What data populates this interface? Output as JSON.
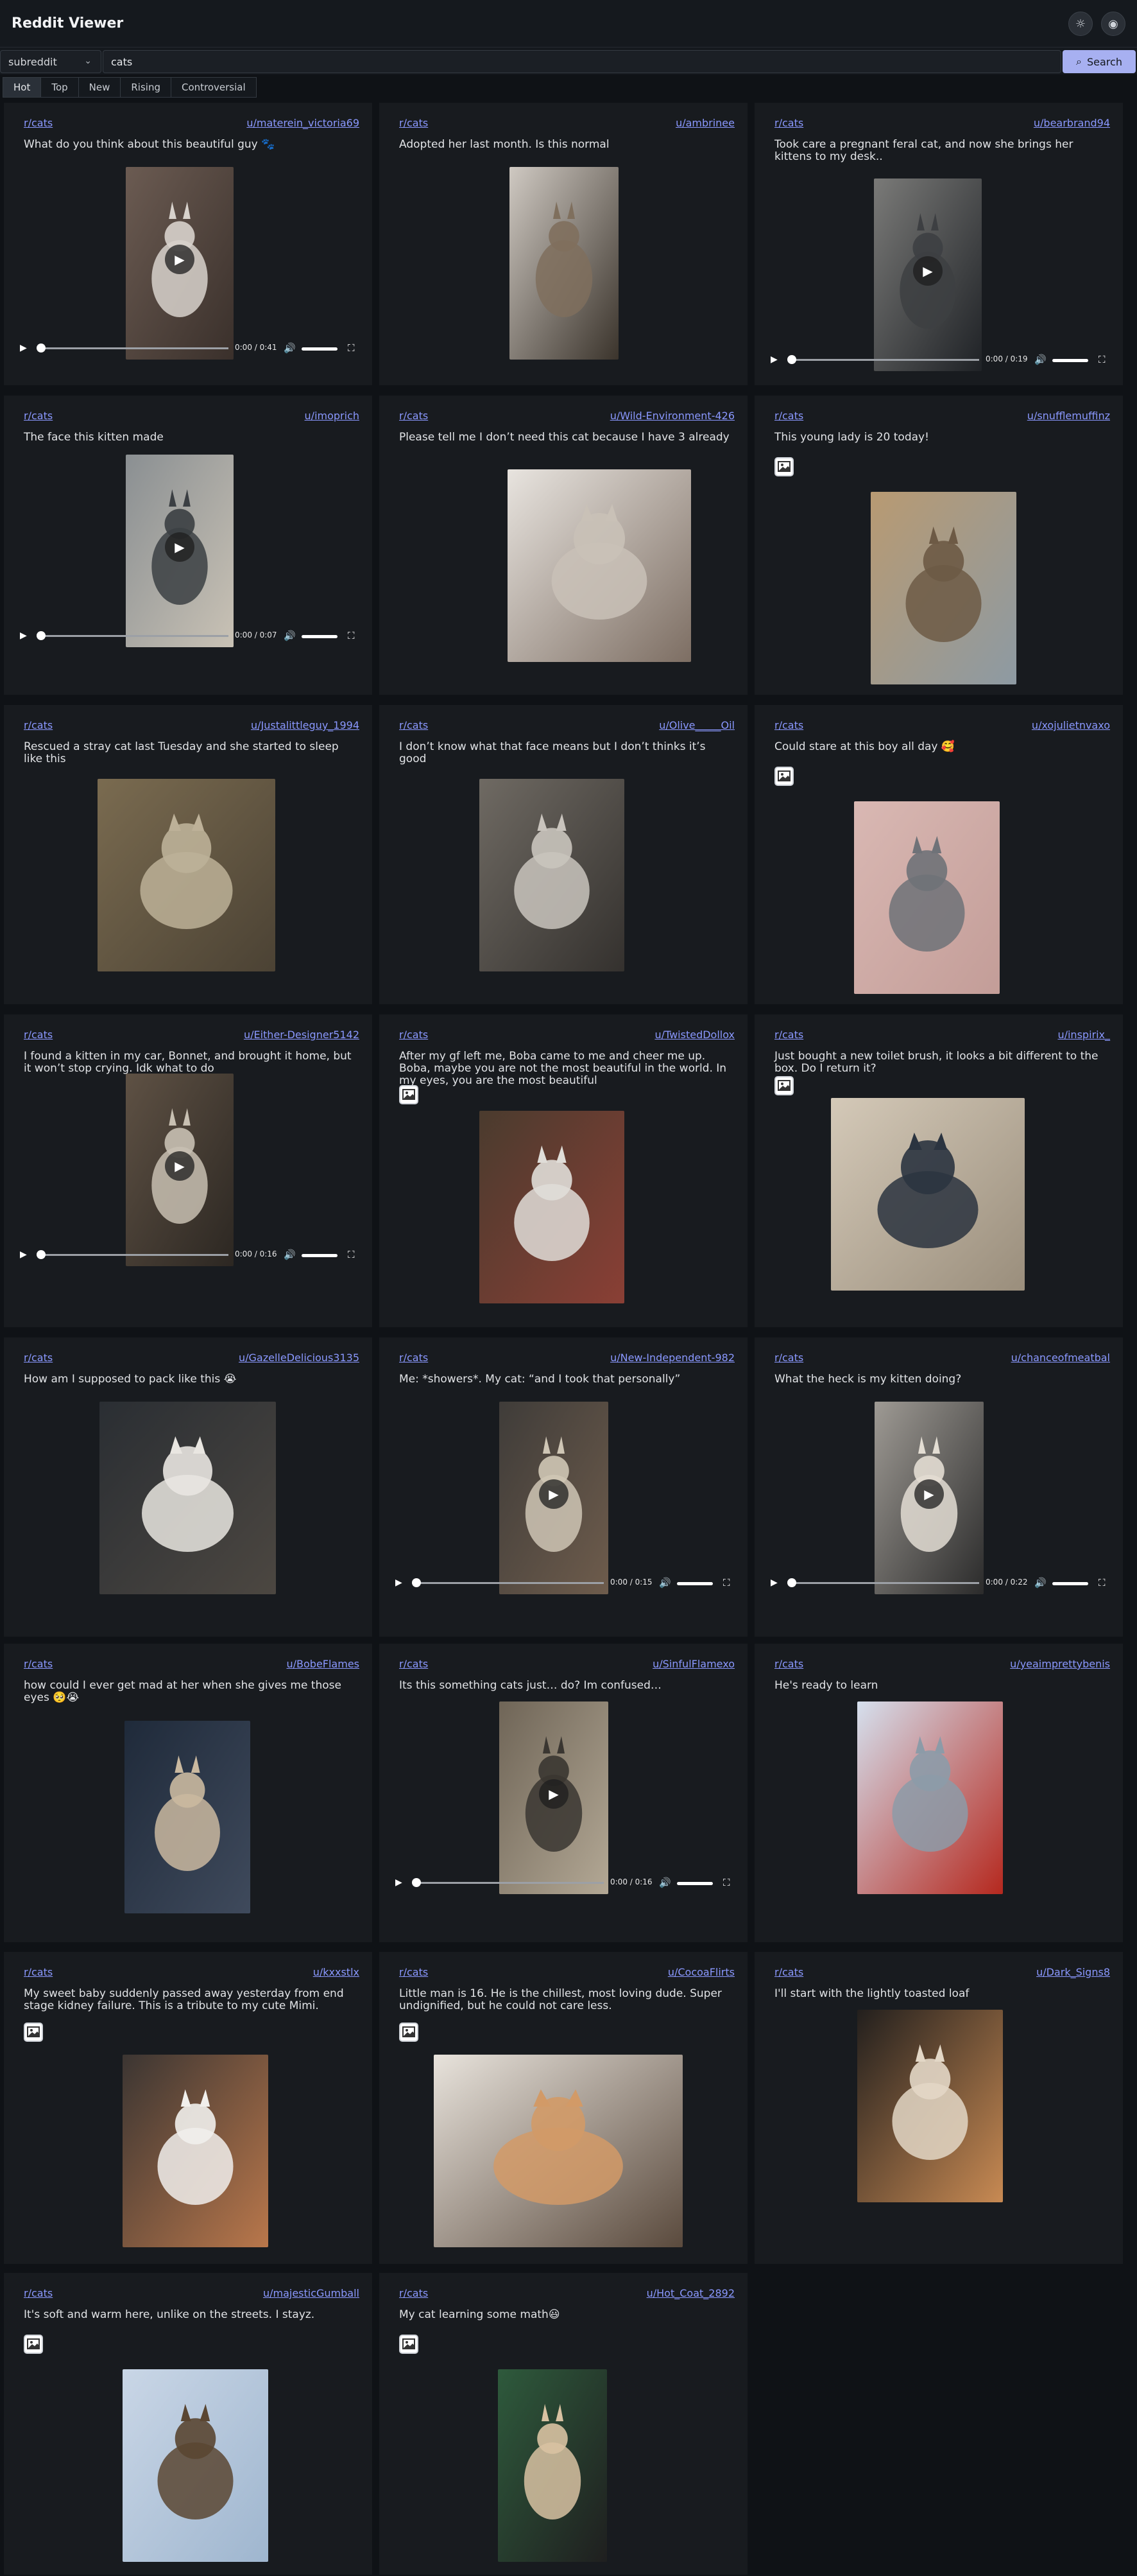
{
  "app": {
    "title": "Reddit Viewer"
  },
  "header": {
    "theme_icon": "sun-icon",
    "github_icon": "github-icon"
  },
  "search": {
    "select_value": "subreddit",
    "query": "cats",
    "button_label": "Search"
  },
  "tabs": [
    "Hot",
    "Top",
    "New",
    "Rising",
    "Controversial"
  ],
  "active_tab": "Hot",
  "posts": [
    {
      "sub": "r/cats",
      "user": "u/materein_victoria69",
      "title": "What do you think about this beautiful guy 🐾",
      "media": "video",
      "time": "0:00 / 0:41"
    },
    {
      "sub": "r/cats",
      "user": "u/ambrinee",
      "title": "Adopted her last month. Is this normal",
      "media": "image"
    },
    {
      "sub": "r/cats",
      "user": "u/bearbrand94",
      "title": "Took care a pregnant feral cat, and now she brings her kittens to my desk..",
      "media": "video",
      "time": "0:00 / 0:19"
    },
    {
      "sub": "r/cats",
      "user": "u/imoprich",
      "title": "The face this kitten made",
      "media": "video",
      "time": "0:00 / 0:07"
    },
    {
      "sub": "r/cats",
      "user": "u/Wild-Environment-426",
      "title": "Please tell me I don’t need this cat because I have 3 already",
      "media": "image"
    },
    {
      "sub": "r/cats",
      "user": "u/snufflemuffinz",
      "title": "This young lady is 20 today!",
      "media": "gallery"
    },
    {
      "sub": "r/cats",
      "user": "u/Justalittleguy_1994",
      "title": "Rescued a stray cat last Tuesday and she started to sleep like this",
      "media": "image"
    },
    {
      "sub": "r/cats",
      "user": "u/Olive_____Oil",
      "title": "I don’t know what that face means but I don’t thinks it’s good",
      "media": "image"
    },
    {
      "sub": "r/cats",
      "user": "u/xojulietnvaxo",
      "title": "Could stare at this boy all day 🥰",
      "media": "gallery"
    },
    {
      "sub": "r/cats",
      "user": "u/Either-Designer5142",
      "title": "I found a kitten in my car, Bonnet, and brought it home, but it won’t stop crying. Idk what to do",
      "media": "video",
      "time": "0:00 / 0:16"
    },
    {
      "sub": "r/cats",
      "user": "u/TwistedDollox",
      "title": "After my gf left me, Boba came to me and cheer me up. Boba, maybe you are not the most beautiful in the world. In my eyes, you are the most beautiful",
      "media": "gallery"
    },
    {
      "sub": "r/cats",
      "user": "u/inspirix_",
      "title": "Just bought a new toilet brush, it looks a bit different to the box. Do I return it?",
      "media": "gallery"
    },
    {
      "sub": "r/cats",
      "user": "u/GazelleDelicious3135",
      "title": "How am I supposed to pack like this 😭",
      "media": "image"
    },
    {
      "sub": "r/cats",
      "user": "u/New-Independent-982",
      "title": "Me: *showers*. My cat: “and I took that personally”",
      "media": "video",
      "time": "0:00 / 0:15"
    },
    {
      "sub": "r/cats",
      "user": "u/chanceofmeatbal",
      "title": "What the heck is my kitten doing?",
      "media": "video",
      "time": "0:00 / 0:22"
    },
    {
      "sub": "r/cats",
      "user": "u/BobeFlames",
      "title": "how could I ever get mad at her when she gives me those eyes 🥺😭",
      "media": "image"
    },
    {
      "sub": "r/cats",
      "user": "u/SinfulFlamexo",
      "title": "Its this something cats just… do? Im confused…",
      "media": "video",
      "time": "0:00 / 0:16"
    },
    {
      "sub": "r/cats",
      "user": "u/yeaimprettybenis",
      "title": "He's ready to learn",
      "media": "image"
    },
    {
      "sub": "r/cats",
      "user": "u/kxxstlx",
      "title": "My sweet baby suddenly passed away yesterday from end stage kidney failure. This is a tribute to my cute Mimi.",
      "media": "gallery"
    },
    {
      "sub": "r/cats",
      "user": "u/CocoaFlirts",
      "title": "Little man is 16. He is the chillest, most loving dude. Super undignified, but he could not care less.",
      "media": "gallery"
    },
    {
      "sub": "r/cats",
      "user": "u/Dark_Signs8",
      "title": "I'll start with the lightly toasted loaf",
      "media": "image"
    },
    {
      "sub": "r/cats",
      "user": "u/majesticGumball",
      "title": "It's soft and warm here, unlike on the streets. I stayz.",
      "media": "gallery"
    },
    {
      "sub": "r/cats",
      "user": "u/Hot_Coat_2892",
      "title": "My cat learning some math😃",
      "media": "gallery"
    }
  ],
  "colors": {
    "accent": "#8a98ff",
    "button": "#a7b0f1",
    "card": "#181b1f",
    "page": "#0f1216"
  }
}
